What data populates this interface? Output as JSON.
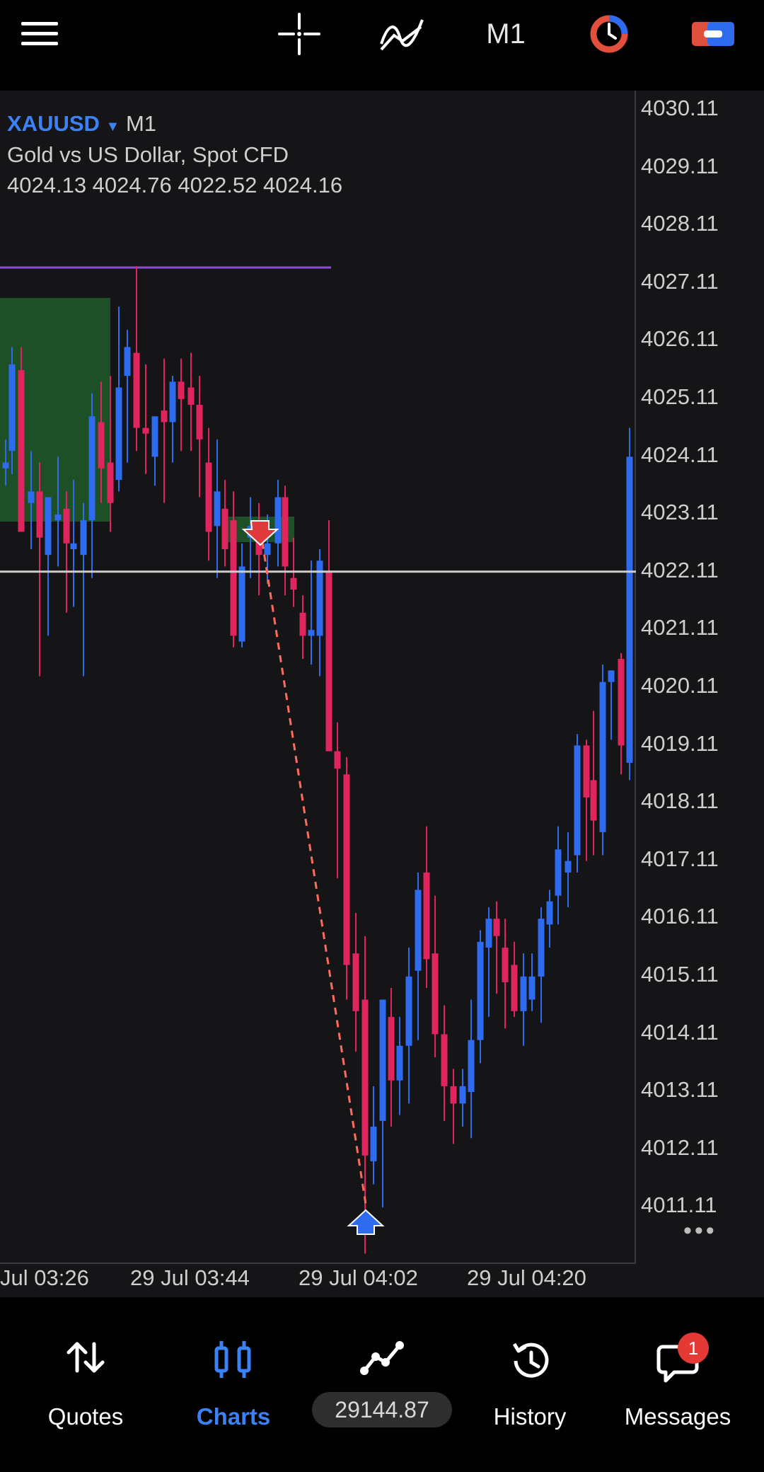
{
  "toolbar": {
    "timeframe": "M1",
    "icons": [
      "menu-icon",
      "crosshair-icon",
      "indicators-icon",
      "timeframe",
      "one-click-trading-icon",
      "trade-icon"
    ]
  },
  "chart": {
    "symbol": "XAUUSD",
    "timeframe": "M1",
    "description": "Gold vs US Dollar, Spot CFD",
    "ohlc": "4024.13 4024.76 4022.52 4024.16",
    "price_axis": [
      "4030.11",
      "4029.11",
      "4028.11",
      "4027.11",
      "4026.11",
      "4025.11",
      "4024.11",
      "4023.11",
      "4022.11",
      "4021.11",
      "4020.11",
      "4019.11",
      "4018.11",
      "4017.11",
      "4016.11",
      "4015.11",
      "4014.11",
      "4013.11",
      "4012.11",
      "4011.11"
    ],
    "time_axis": [
      "Jul 03:26",
      "29 Jul 03:44",
      "29 Jul 04:02",
      "29 Jul 04:20"
    ],
    "current_price_line": 4022.11,
    "colors": {
      "bull": "#2f6bef",
      "bear": "#e0245e",
      "grid_line": "#cccccc",
      "level_line": "#8b4fd6",
      "zone": "#1e5a2a",
      "trade_line": "#ff6b5b"
    }
  },
  "chart_data": {
    "type": "candlestick",
    "symbol": "XAUUSD",
    "timeframe": "M1",
    "ylim": [
      4010.3,
      4030.6
    ],
    "x": [
      "Jul 03:26",
      "29 Jul 03:44",
      "29 Jul 04:02",
      "29 Jul 04:20"
    ],
    "candles_close": [
      4024.0,
      4025.7,
      4022.8,
      4023.5,
      4022.7,
      4023.4,
      4024.8,
      4025.5,
      4024.6,
      4023.3,
      4025.4,
      4024.4,
      4024.8,
      4024.7,
      4025.5,
      4025.1,
      4024.0,
      4023.4,
      4022.3,
      4021.0,
      4022.1,
      4023.8,
      4022.9,
      4022.2,
      4021.4,
      4021.3,
      4022.0,
      4021.3,
      4019.0,
      4017.5,
      4015.7,
      4014.5,
      4012.5,
      4013.0,
      4013.5,
      4015.0,
      4014.5,
      4017.0,
      4016.0,
      4014.0,
      4012.0,
      4012.7,
      4014.0,
      4015.5,
      4015.4,
      4015.8,
      4015.2,
      4014.5,
      4014.6,
      4015.4,
      4016.0,
      4017.3,
      4018.2,
      4017.8,
      4020.2,
      4019.1,
      4024.1
    ]
  },
  "navbar": {
    "items": [
      {
        "label": "Quotes",
        "icon": "quotes-icon"
      },
      {
        "label": "Charts",
        "icon": "charts-icon"
      },
      {
        "label": "29144.87",
        "icon": "trade-icon"
      },
      {
        "label": "History",
        "icon": "history-icon"
      },
      {
        "label": "Messages",
        "icon": "messages-icon"
      }
    ],
    "messages_badge": "1"
  }
}
